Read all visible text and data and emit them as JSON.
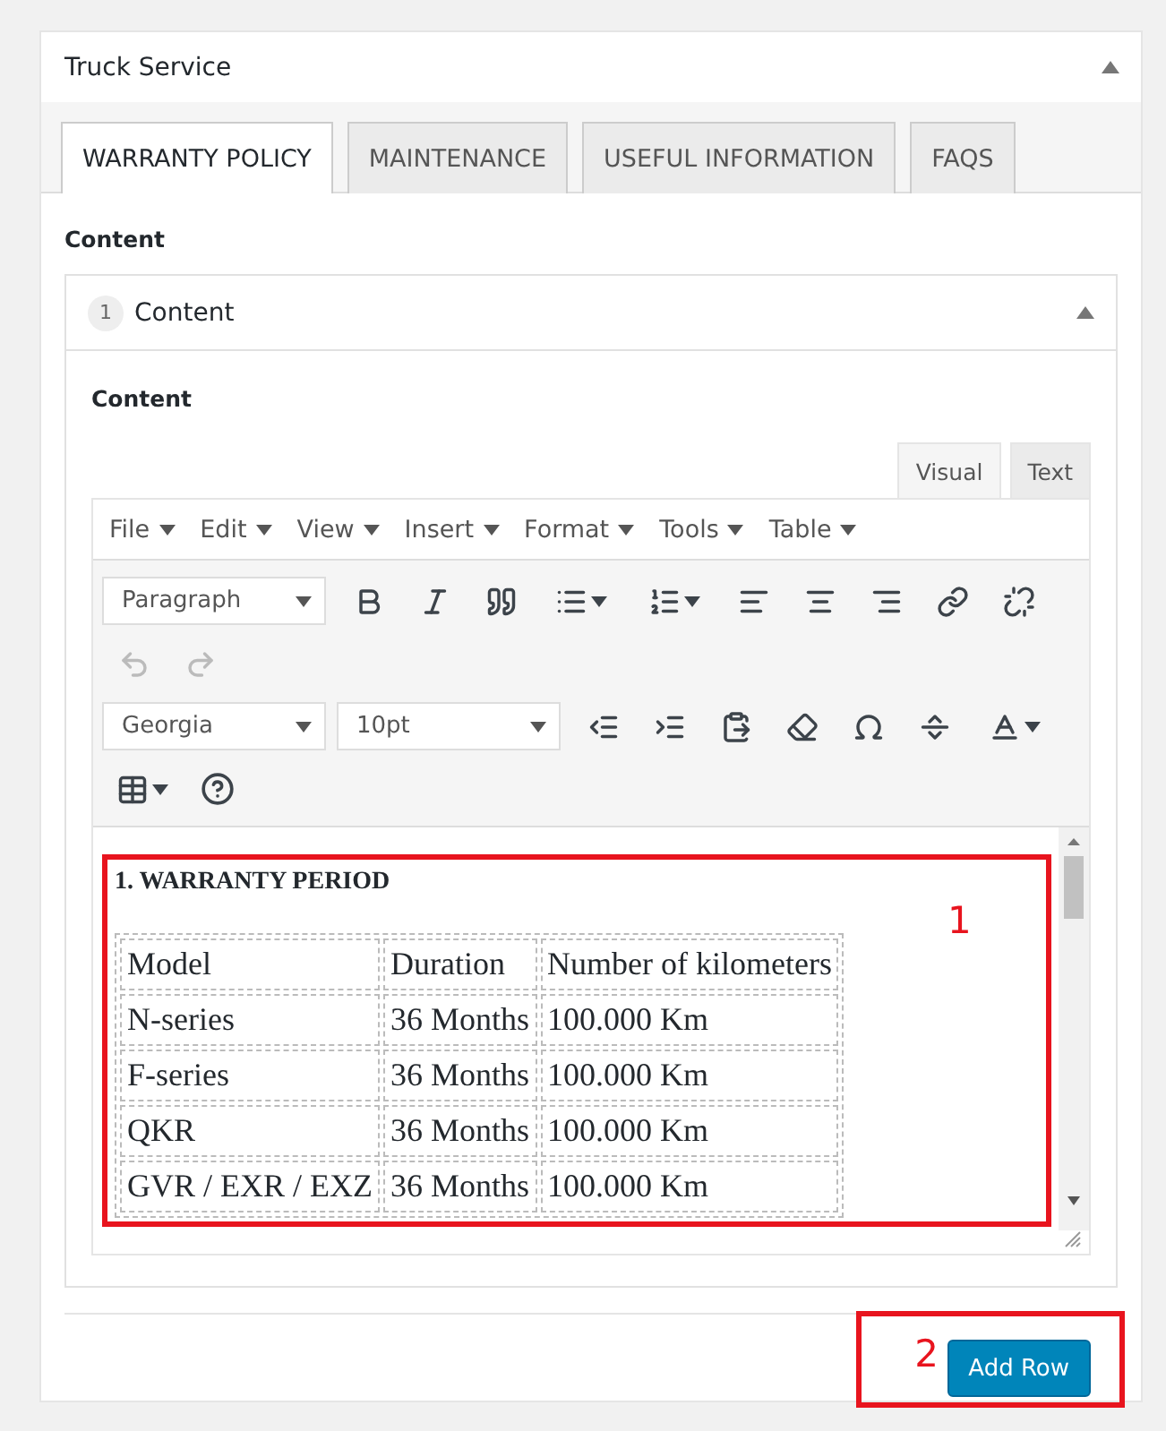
{
  "panel": {
    "title": "Truck Service",
    "collapsed": false
  },
  "tabs": [
    {
      "label": "WARRANTY POLICY",
      "selected": true
    },
    {
      "label": "MAINTENANCE",
      "selected": false
    },
    {
      "label": "USEFUL INFORMATION",
      "selected": false
    },
    {
      "label": "FAQS",
      "selected": false
    }
  ],
  "section_label": "Content",
  "repeater_item": {
    "index": "1",
    "title": "Content",
    "collapsed": false,
    "field_label": "Content",
    "editor": {
      "modes": [
        {
          "label": "Visual",
          "selected": true
        },
        {
          "label": "Text",
          "selected": false
        }
      ],
      "menu": [
        "File",
        "Edit",
        "View",
        "Insert",
        "Format",
        "Tools",
        "Table"
      ],
      "block_format": "Paragraph",
      "font_family": "Georgia",
      "font_size": "10pt",
      "history": [
        {
          "kind": "undo",
          "disabled": true
        },
        {
          "kind": "redo",
          "disabled": true
        }
      ],
      "content": {
        "heading": "1. WARRANTY PERIOD",
        "table": {
          "columns": [
            "Model",
            "Duration",
            "Number of kilometers"
          ],
          "rows": [
            [
              "N-series",
              "36 Months",
              "100.000 Km"
            ],
            [
              "F-series",
              "36 Months",
              "100.000 Km"
            ],
            [
              "QKR",
              "36 Months",
              "100.000 Km"
            ],
            [
              "GVR / EXR / EXZ",
              "36 Months",
              "100.000 Km"
            ]
          ]
        }
      }
    }
  },
  "add_button": "Add Row",
  "annotations": [
    {
      "label": "1"
    },
    {
      "label": "2"
    }
  ]
}
